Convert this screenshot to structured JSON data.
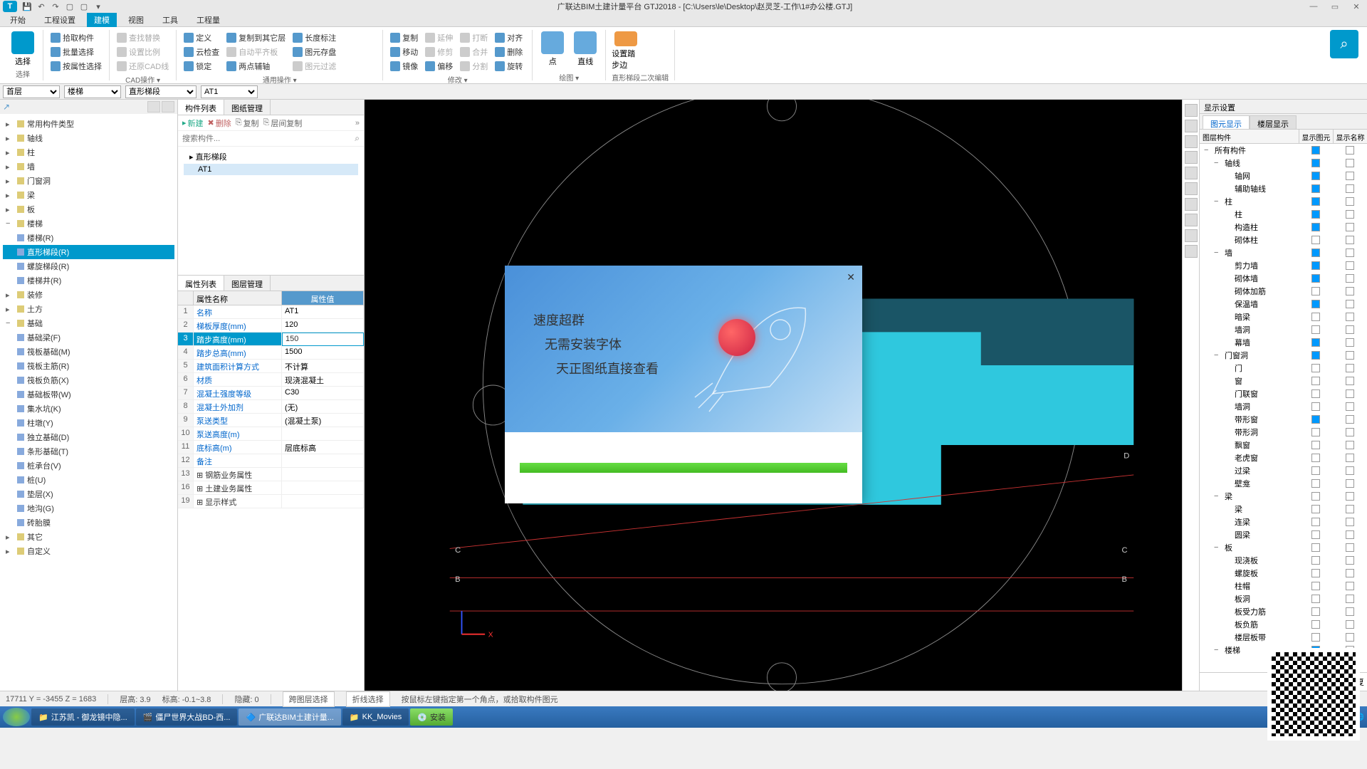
{
  "titlebar": {
    "logo": "T",
    "title": "广联达BIM土建计量平台 GTJ2018 - [C:\\Users\\le\\Desktop\\赵灵芝-工作\\1#办公楼.GTJ]"
  },
  "menubar": {
    "tabs": [
      "开始",
      "工程设置",
      "建模",
      "视图",
      "工具",
      "工程量"
    ],
    "active": 2
  },
  "ribbon": {
    "groups": [
      {
        "label": "选择",
        "big": "选择",
        "items": []
      },
      {
        "label": "",
        "items": [
          "拾取构件",
          "批量选择",
          "按属性选择"
        ]
      },
      {
        "label": "CAD操作 ▾",
        "items": [
          "查找替换",
          "设置比例",
          "还原CAD线"
        ]
      },
      {
        "label": "通用操作 ▾",
        "items": [
          "定义",
          "云检查",
          "锁定",
          "复制到其它层",
          "自动平齐板",
          "两点辅轴",
          "长度标注",
          "图元存盘",
          "图元过滤"
        ]
      },
      {
        "label": "修改 ▾",
        "items": [
          "复制",
          "移动",
          "镜像",
          "延伸",
          "修剪",
          "偏移",
          "打断",
          "合并",
          "分割",
          "对齐",
          "删除",
          "旋转"
        ]
      },
      {
        "label": "绘图 ▾",
        "big_items": [
          "点",
          "直线"
        ]
      },
      {
        "label": "",
        "big": "设置踏步边"
      },
      {
        "label": "直形梯段二次编辑"
      }
    ]
  },
  "filterbar": {
    "selects": [
      "首层",
      "楼梯",
      "直形梯段",
      "AT1"
    ]
  },
  "left_tree": {
    "items": [
      {
        "t": "常用构件类型",
        "l": 0,
        "b": "y"
      },
      {
        "t": "轴线",
        "l": 0,
        "b": "y"
      },
      {
        "t": "柱",
        "l": 0,
        "b": "y"
      },
      {
        "t": "墙",
        "l": 0,
        "b": "y"
      },
      {
        "t": "门窗洞",
        "l": 0,
        "b": "y"
      },
      {
        "t": "梁",
        "l": 0,
        "b": "y"
      },
      {
        "t": "板",
        "l": 0,
        "b": "y"
      },
      {
        "t": "楼梯",
        "l": 0,
        "b": "y",
        "exp": "−"
      },
      {
        "t": "楼梯(R)",
        "l": 1,
        "b": "b"
      },
      {
        "t": "直形梯段(R)",
        "l": 1,
        "b": "b",
        "active": true
      },
      {
        "t": "螺旋梯段(R)",
        "l": 1,
        "b": "b"
      },
      {
        "t": "楼梯井(R)",
        "l": 1,
        "b": "b"
      },
      {
        "t": "装修",
        "l": 0,
        "b": "y"
      },
      {
        "t": "土方",
        "l": 0,
        "b": "y"
      },
      {
        "t": "基础",
        "l": 0,
        "b": "y",
        "exp": "−"
      },
      {
        "t": "基础梁(F)",
        "l": 1,
        "b": "b"
      },
      {
        "t": "筏板基础(M)",
        "l": 1,
        "b": "b"
      },
      {
        "t": "筏板主筋(R)",
        "l": 1,
        "b": "b"
      },
      {
        "t": "筏板负筋(X)",
        "l": 1,
        "b": "b"
      },
      {
        "t": "基础板带(W)",
        "l": 1,
        "b": "b"
      },
      {
        "t": "集水坑(K)",
        "l": 1,
        "b": "b"
      },
      {
        "t": "柱墩(Y)",
        "l": 1,
        "b": "b"
      },
      {
        "t": "独立基础(D)",
        "l": 1,
        "b": "b"
      },
      {
        "t": "条形基础(T)",
        "l": 1,
        "b": "b"
      },
      {
        "t": "桩承台(V)",
        "l": 1,
        "b": "b"
      },
      {
        "t": "桩(U)",
        "l": 1,
        "b": "b"
      },
      {
        "t": "垫层(X)",
        "l": 1,
        "b": "b"
      },
      {
        "t": "地沟(G)",
        "l": 1,
        "b": "b"
      },
      {
        "t": "砖胎膜",
        "l": 1,
        "b": "b"
      },
      {
        "t": "其它",
        "l": 0,
        "b": "y"
      },
      {
        "t": "自定义",
        "l": 0,
        "b": "y"
      }
    ]
  },
  "comp_panel": {
    "tabs": [
      "构件列表",
      "图纸管理"
    ],
    "toolbar": [
      "新建",
      "删除",
      "复制",
      "层间复制"
    ],
    "search_placeholder": "搜索构件...",
    "items": [
      "▸ 直形梯段",
      "  AT1"
    ]
  },
  "prop_panel": {
    "tabs": [
      "属性列表",
      "图层管理"
    ],
    "headers": [
      "",
      "属性名称",
      "属性值"
    ],
    "rows": [
      {
        "n": "1",
        "k": "名称",
        "v": "AT1",
        "blue": true
      },
      {
        "n": "2",
        "k": "梯板厚度(mm)",
        "v": "120",
        "blue": true
      },
      {
        "n": "3",
        "k": "踏步高度(mm)",
        "v": "150",
        "blue": true,
        "sel": true
      },
      {
        "n": "4",
        "k": "踏步总高(mm)",
        "v": "1500",
        "blue": true
      },
      {
        "n": "5",
        "k": "建筑面积计算方式",
        "v": "不计算",
        "blue": true
      },
      {
        "n": "6",
        "k": "材质",
        "v": "现浇混凝土",
        "blue": true
      },
      {
        "n": "7",
        "k": "混凝土强度等级",
        "v": "C30",
        "blue": true
      },
      {
        "n": "8",
        "k": "混凝土外加剂",
        "v": "(无)",
        "blue": true
      },
      {
        "n": "9",
        "k": "泵送类型",
        "v": "(混凝土泵)",
        "blue": true
      },
      {
        "n": "10",
        "k": "泵送高度(m)",
        "v": "",
        "blue": true
      },
      {
        "n": "11",
        "k": "底标高(m)",
        "v": "层底标高",
        "blue": true
      },
      {
        "n": "12",
        "k": "备注",
        "v": "",
        "blue": true
      },
      {
        "n": "13",
        "k": "钢筋业务属性",
        "v": "",
        "expand": true
      },
      {
        "n": "16",
        "k": "土建业务属性",
        "v": "",
        "expand": true
      },
      {
        "n": "19",
        "k": "显示样式",
        "v": "",
        "expand": true
      }
    ]
  },
  "right_panel": {
    "title": "显示设置",
    "subtabs": [
      "图元显示",
      "楼层显示"
    ],
    "headers": [
      "图层构件",
      "显示图元",
      "显示名称"
    ],
    "rows": [
      {
        "t": "所有构件",
        "l": 0,
        "c1": true,
        "c2": false,
        "exp": "−"
      },
      {
        "t": "轴线",
        "l": 1,
        "c1": true,
        "c2": false,
        "exp": "−"
      },
      {
        "t": "轴网",
        "l": 2,
        "c1": true,
        "c2": false
      },
      {
        "t": "辅助轴线",
        "l": 2,
        "c1": true,
        "c2": false
      },
      {
        "t": "柱",
        "l": 1,
        "c1": true,
        "c2": false,
        "exp": "−"
      },
      {
        "t": "柱",
        "l": 2,
        "c1": true,
        "c2": false
      },
      {
        "t": "构造柱",
        "l": 2,
        "c1": true,
        "c2": false
      },
      {
        "t": "砌体柱",
        "l": 2,
        "c1": false,
        "c2": false
      },
      {
        "t": "墙",
        "l": 1,
        "c1": true,
        "c2": false,
        "exp": "−"
      },
      {
        "t": "剪力墙",
        "l": 2,
        "c1": true,
        "c2": false
      },
      {
        "t": "砌体墙",
        "l": 2,
        "c1": true,
        "c2": false
      },
      {
        "t": "砌体加筋",
        "l": 2,
        "c1": false,
        "c2": false
      },
      {
        "t": "保温墙",
        "l": 2,
        "c1": true,
        "c2": false
      },
      {
        "t": "暗梁",
        "l": 2,
        "c1": false,
        "c2": false
      },
      {
        "t": "墙洞",
        "l": 2,
        "c1": false,
        "c2": false
      },
      {
        "t": "幕墙",
        "l": 2,
        "c1": true,
        "c2": false
      },
      {
        "t": "门窗洞",
        "l": 1,
        "c1": true,
        "c2": false,
        "exp": "−"
      },
      {
        "t": "门",
        "l": 2,
        "c1": false,
        "c2": false
      },
      {
        "t": "窗",
        "l": 2,
        "c1": false,
        "c2": false
      },
      {
        "t": "门联窗",
        "l": 2,
        "c1": false,
        "c2": false
      },
      {
        "t": "墙洞",
        "l": 2,
        "c1": false,
        "c2": false
      },
      {
        "t": "带形窗",
        "l": 2,
        "c1": true,
        "c2": false
      },
      {
        "t": "带形洞",
        "l": 2,
        "c1": false,
        "c2": false
      },
      {
        "t": "飘窗",
        "l": 2,
        "c1": false,
        "c2": false
      },
      {
        "t": "老虎窗",
        "l": 2,
        "c1": false,
        "c2": false
      },
      {
        "t": "过梁",
        "l": 2,
        "c1": false,
        "c2": false
      },
      {
        "t": "壁龛",
        "l": 2,
        "c1": false,
        "c2": false
      },
      {
        "t": "梁",
        "l": 1,
        "c1": false,
        "c2": false,
        "exp": "−"
      },
      {
        "t": "梁",
        "l": 2,
        "c1": false,
        "c2": false
      },
      {
        "t": "连梁",
        "l": 2,
        "c1": false,
        "c2": false
      },
      {
        "t": "圆梁",
        "l": 2,
        "c1": false,
        "c2": false
      },
      {
        "t": "板",
        "l": 1,
        "c1": false,
        "c2": false,
        "exp": "−"
      },
      {
        "t": "现浇板",
        "l": 2,
        "c1": false,
        "c2": false
      },
      {
        "t": "螺旋板",
        "l": 2,
        "c1": false,
        "c2": false
      },
      {
        "t": "柱帽",
        "l": 2,
        "c1": false,
        "c2": false
      },
      {
        "t": "板洞",
        "l": 2,
        "c1": false,
        "c2": false
      },
      {
        "t": "板受力筋",
        "l": 2,
        "c1": false,
        "c2": false
      },
      {
        "t": "板负筋",
        "l": 2,
        "c1": false,
        "c2": false
      },
      {
        "t": "楼层板带",
        "l": 2,
        "c1": false,
        "c2": false
      },
      {
        "t": "楼梯",
        "l": 1,
        "c1": true,
        "c2": false,
        "exp": "−"
      }
    ],
    "recover": "恢复"
  },
  "modal": {
    "lines": [
      "速度超群",
      "无需安装字体",
      "天正图纸直接查看"
    ]
  },
  "statusbar": {
    "coords": "17711 Y = -3455 Z = 1683",
    "floor_h": "层高:  3.9",
    "elev": "标高:  -0.1~3.8",
    "hidden": "隐藏:  0",
    "btn1": "跨图层选择",
    "btn2": "折线选择",
    "hint": "按鼠标左键指定第一个角点，或拾取构件图元"
  },
  "taskbar": {
    "items": [
      "江苏凯 - 御龙镜中隐...",
      "僵尸世界大战BD-西...",
      "广联达BIM土建计量...",
      "KK_Movies",
      "安装"
    ]
  }
}
